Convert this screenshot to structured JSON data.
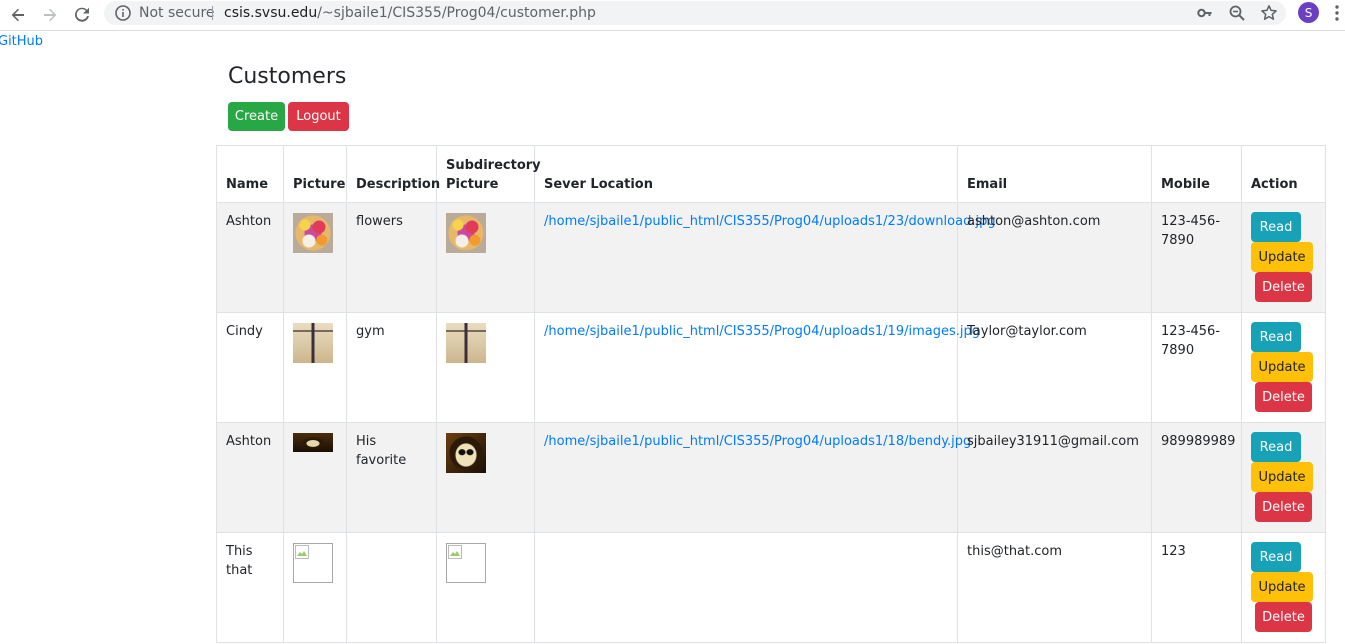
{
  "browser": {
    "security_label": "Not secure",
    "url_host": "csis.svsu.edu",
    "url_path": "/~sjbaile1/CIS355/Prog04/customer.php",
    "profile_initial": "S",
    "profile_color": "#6a3fc0"
  },
  "page": {
    "github_link": "GitHub",
    "title": "Customers",
    "create_label": "Create",
    "logout_label": "Logout"
  },
  "table": {
    "headers": {
      "name": "Name",
      "picture": "Picture",
      "description": "Description",
      "subdir_picture": "Subdirectory Picture",
      "server_location": "Sever Location",
      "email": "Email",
      "mobile": "Mobile",
      "action": "Action"
    },
    "rows": [
      {
        "name": "Ashton",
        "picture": "flowers-thumbnail",
        "description": "flowers",
        "subdir_picture": "flowers-thumbnail",
        "server_location": "/home/sjbaile1/public_html/CIS355/Prog04/uploads1/23/download.jpg",
        "email": "ashton@ashton.com",
        "mobile": "123-456-7890"
      },
      {
        "name": "Cindy",
        "picture": "gym-thumbnail",
        "description": "gym",
        "subdir_picture": "gym-thumbnail",
        "server_location": "/home/sjbaile1/public_html/CIS355/Prog04/uploads1/19/images.jpg",
        "email": "Taylor@taylor.com",
        "mobile": "123-456-7890"
      },
      {
        "name": "Ashton",
        "picture": "bendy-thumbnail",
        "description": "His favorite",
        "subdir_picture": "bendy-thumbnail",
        "server_location": "/home/sjbaile1/public_html/CIS355/Prog04/uploads1/18/bendy.jpg",
        "email": "sjbailey31911@gmail.com",
        "mobile": "989989989"
      },
      {
        "name": "This that",
        "picture": "broken-image-icon",
        "description": "",
        "subdir_picture": "broken-image-icon",
        "server_location": "",
        "email": "this@that.com",
        "mobile": "123"
      }
    ],
    "actions": {
      "read": "Read",
      "update": "Update",
      "delete": "Delete"
    }
  },
  "colors": {
    "link": "#007bff",
    "create": "#28a745",
    "logout": "#dc3545",
    "read": "#17a2b8",
    "update": "#ffc107",
    "delete": "#dc3545",
    "stripe": "#f2f2f2"
  }
}
